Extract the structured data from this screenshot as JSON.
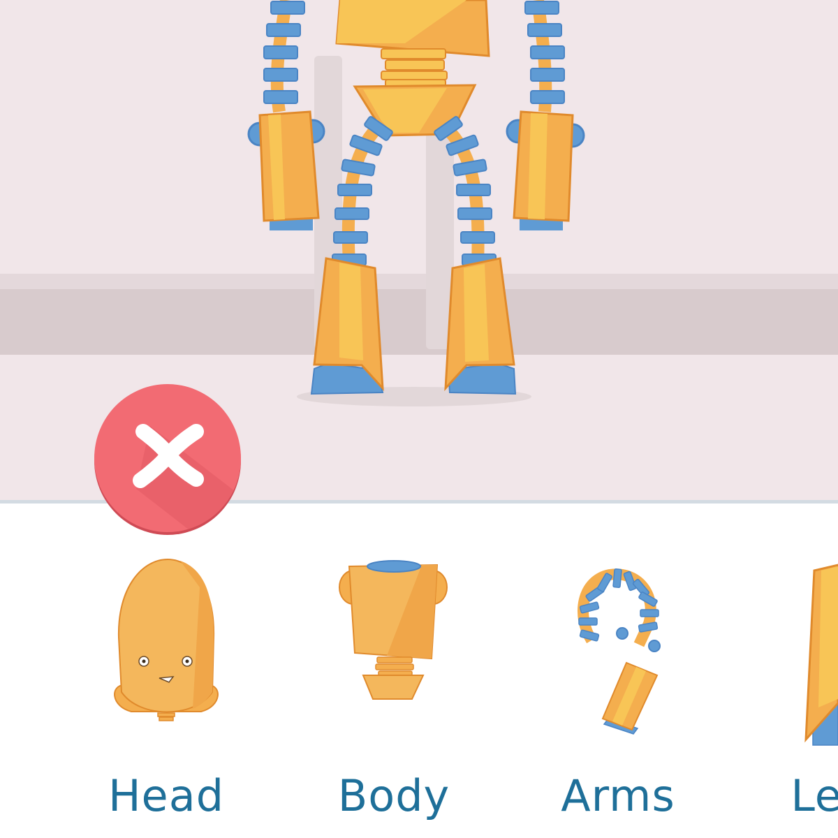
{
  "stage": {
    "background": "#f1e6e9",
    "robot_colors": {
      "orange": "#f4ae4e",
      "orange_light": "#f8c556",
      "outline": "#e08a2c",
      "blue": "#5f9bd4",
      "blue_outline": "#4a84c4"
    }
  },
  "close_button": {
    "icon": "close-icon",
    "color": "#f26b73"
  },
  "parts_tray": {
    "label_color": "#1e6f99",
    "items": [
      {
        "label": "Head",
        "icon": "robot-head-icon"
      },
      {
        "label": "Body",
        "icon": "robot-body-icon"
      },
      {
        "label": "Arms",
        "icon": "robot-arm-icon"
      },
      {
        "label": "Legs",
        "icon": "robot-leg-icon"
      }
    ]
  }
}
